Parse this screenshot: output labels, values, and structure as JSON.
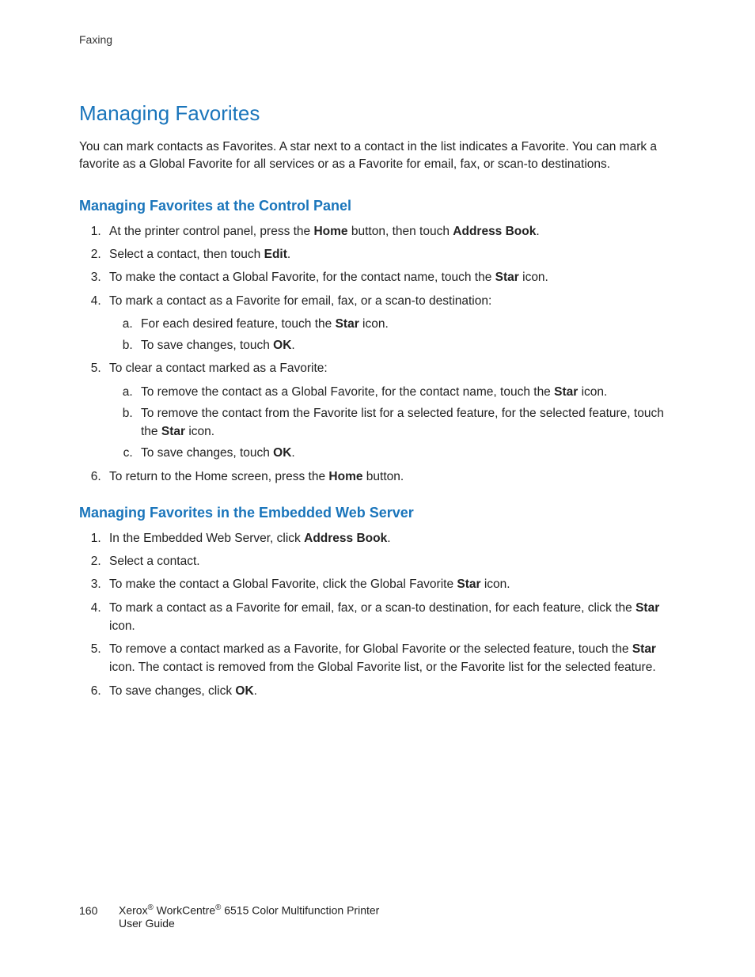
{
  "header": {
    "section": "Faxing"
  },
  "title": "Managing Favorites",
  "intro": "You can mark contacts as Favorites. A star next to a contact in the list indicates a Favorite. You can mark a favorite as a Global Favorite for all services or as a Favorite for email, fax, or scan-to destinations.",
  "section1": {
    "heading": "Managing Favorites at the Control Panel",
    "step1_a": "At the printer control panel, press the ",
    "step1_b": "Home",
    "step1_c": " button, then touch ",
    "step1_d": "Address Book",
    "step1_e": ".",
    "step2_a": "Select a contact, then touch ",
    "step2_b": "Edit",
    "step2_c": ".",
    "step3_a": "To make the contact a Global Favorite, for the contact name, touch the ",
    "step3_b": "Star",
    "step3_c": " icon.",
    "step4": "To mark a contact as a Favorite for email, fax, or a scan-to destination:",
    "step4a_a": "For each desired feature, touch the ",
    "step4a_b": "Star",
    "step4a_c": " icon.",
    "step4b_a": "To save changes, touch ",
    "step4b_b": "OK",
    "step4b_c": ".",
    "step5": "To clear a contact marked as a Favorite:",
    "step5a_a": "To remove the contact as a Global Favorite, for the contact name, touch the ",
    "step5a_b": "Star",
    "step5a_c": " icon.",
    "step5b_a": "To remove the contact from the Favorite list for a selected feature, for the selected feature, touch the ",
    "step5b_b": "Star",
    "step5b_c": " icon.",
    "step5c_a": "To save changes, touch ",
    "step5c_b": "OK",
    "step5c_c": ".",
    "step6_a": "To return to the Home screen, press the ",
    "step6_b": "Home",
    "step6_c": " button."
  },
  "section2": {
    "heading": "Managing Favorites in the Embedded Web Server",
    "step1_a": "In the Embedded Web Server, click ",
    "step1_b": "Address Book",
    "step1_c": ".",
    "step2": "Select a contact.",
    "step3_a": "To make the contact a Global Favorite, click the Global Favorite ",
    "step3_b": "Star",
    "step3_c": " icon.",
    "step4_a": "To mark a contact as a Favorite for email, fax, or a scan-to destination, for each feature, click the ",
    "step4_b": "Star",
    "step4_c": " icon.",
    "step5_a": "To remove a contact marked as a Favorite, for Global Favorite or the selected feature, touch the ",
    "step5_b": "Star",
    "step5_c": " icon. The contact is removed from the Global Favorite list, or the Favorite list for the selected feature.",
    "step6_a": "To save changes, click ",
    "step6_b": "OK",
    "step6_c": "."
  },
  "footer": {
    "page_number": "160",
    "brand": "Xerox",
    "product": " WorkCentre",
    "model_suffix": " 6515 Color Multifunction Printer",
    "line2": "User Guide"
  }
}
